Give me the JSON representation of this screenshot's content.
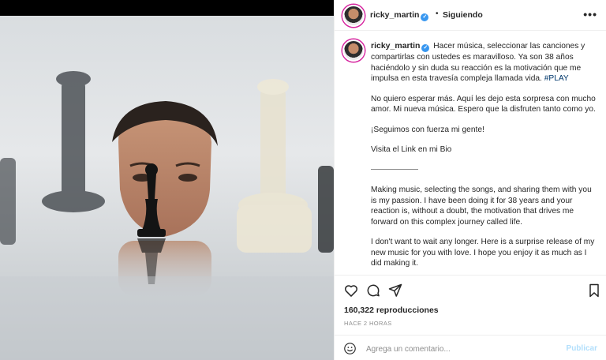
{
  "post": {
    "username": "ricky_martin",
    "separator": "•",
    "follow_label": "Siguiendo",
    "more_label": "•••"
  },
  "caption": {
    "username": "ricky_martin",
    "p1": "Hacer música, seleccionar las canciones y compartirlas con ustedes es maravilloso. Ya son 38 años haciéndolo y sin duda su reacción es la motivación que me impulsa en esta travesía compleja llamada vida.",
    "hashtag": "#PLAY",
    "p2": "No quiero esperar más. Aquí les dejo esta sorpresa con mucho amor. Mi nueva música. Espero que la disfruten tanto como yo.",
    "p3": "¡Seguimos con fuerza mi gente!",
    "p4": "Visita el Link en mi Bio",
    "p5": "Making music, selecting the songs, and sharing them with you is my passion. I have been doing it for 38 years and your reaction is, without a doubt, the motivation that drives me forward on this complex journey called life.",
    "p6": "I don't want to wait any longer. Here is a surprise release of my new music for you with love. I hope you enjoy it as much as I did making it."
  },
  "stats": {
    "views": "160,322 reproducciones",
    "time": "HACE 2 HORAS"
  },
  "comment_box": {
    "placeholder": "Agrega un comentario...",
    "publish_label": "Publicar"
  },
  "icons": [
    "heart-icon",
    "comment-icon",
    "share-icon",
    "bookmark-icon",
    "emoji-icon",
    "verified-icon",
    "more-icon"
  ],
  "colors": {
    "accent": "#3897f0",
    "publish_disabled": "#b2dffc",
    "hashtag": "#00376b"
  }
}
